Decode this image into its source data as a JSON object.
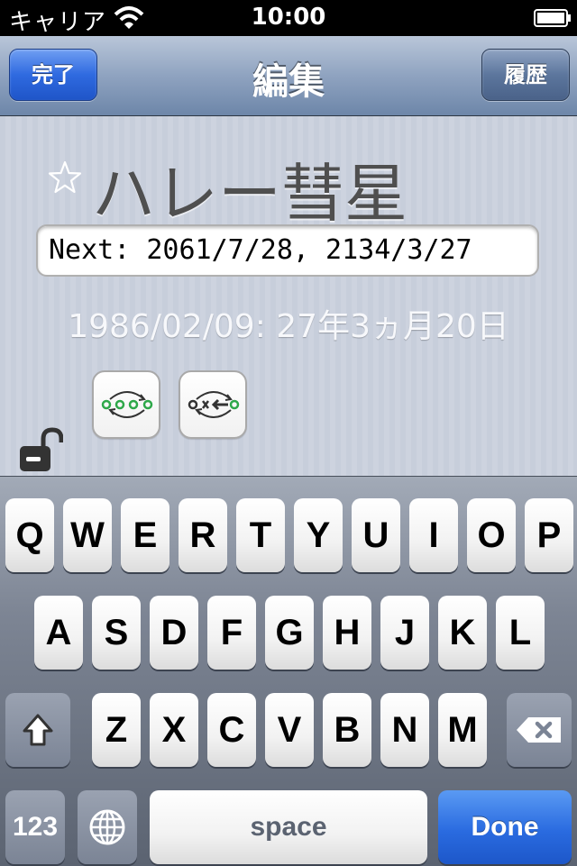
{
  "status": {
    "carrier": "キャリア",
    "time": "10:00"
  },
  "nav": {
    "title": "編集",
    "done_label": "完了",
    "history_label": "履歴"
  },
  "item": {
    "title": "ハレー彗星",
    "note_value": "Next: 2061/7/28, 2134/3/27",
    "elapsed": "1986/02/09: 27年3ヵ月20日"
  },
  "keyboard": {
    "row1": [
      "Q",
      "W",
      "E",
      "R",
      "T",
      "Y",
      "U",
      "I",
      "O",
      "P"
    ],
    "row2": [
      "A",
      "S",
      "D",
      "F",
      "G",
      "H",
      "J",
      "K",
      "L"
    ],
    "row3": [
      "Z",
      "X",
      "C",
      "V",
      "B",
      "N",
      "M"
    ],
    "numbers_label": "123",
    "space_label": "space",
    "return_label": "Done"
  },
  "icons": {
    "wifi": "wifi-icon",
    "battery": "battery-icon",
    "star": "star-outline-icon",
    "lock": "unlocked-padlock-icon",
    "repeat": "repeat-loop-icon",
    "back": "back-arrow-loop-icon",
    "shift": "shift-arrow-icon",
    "delete": "backspace-icon",
    "globe": "globe-icon"
  },
  "colors": {
    "nav_accent": "#2f6ae0",
    "icon_green": "#2ea84a"
  }
}
